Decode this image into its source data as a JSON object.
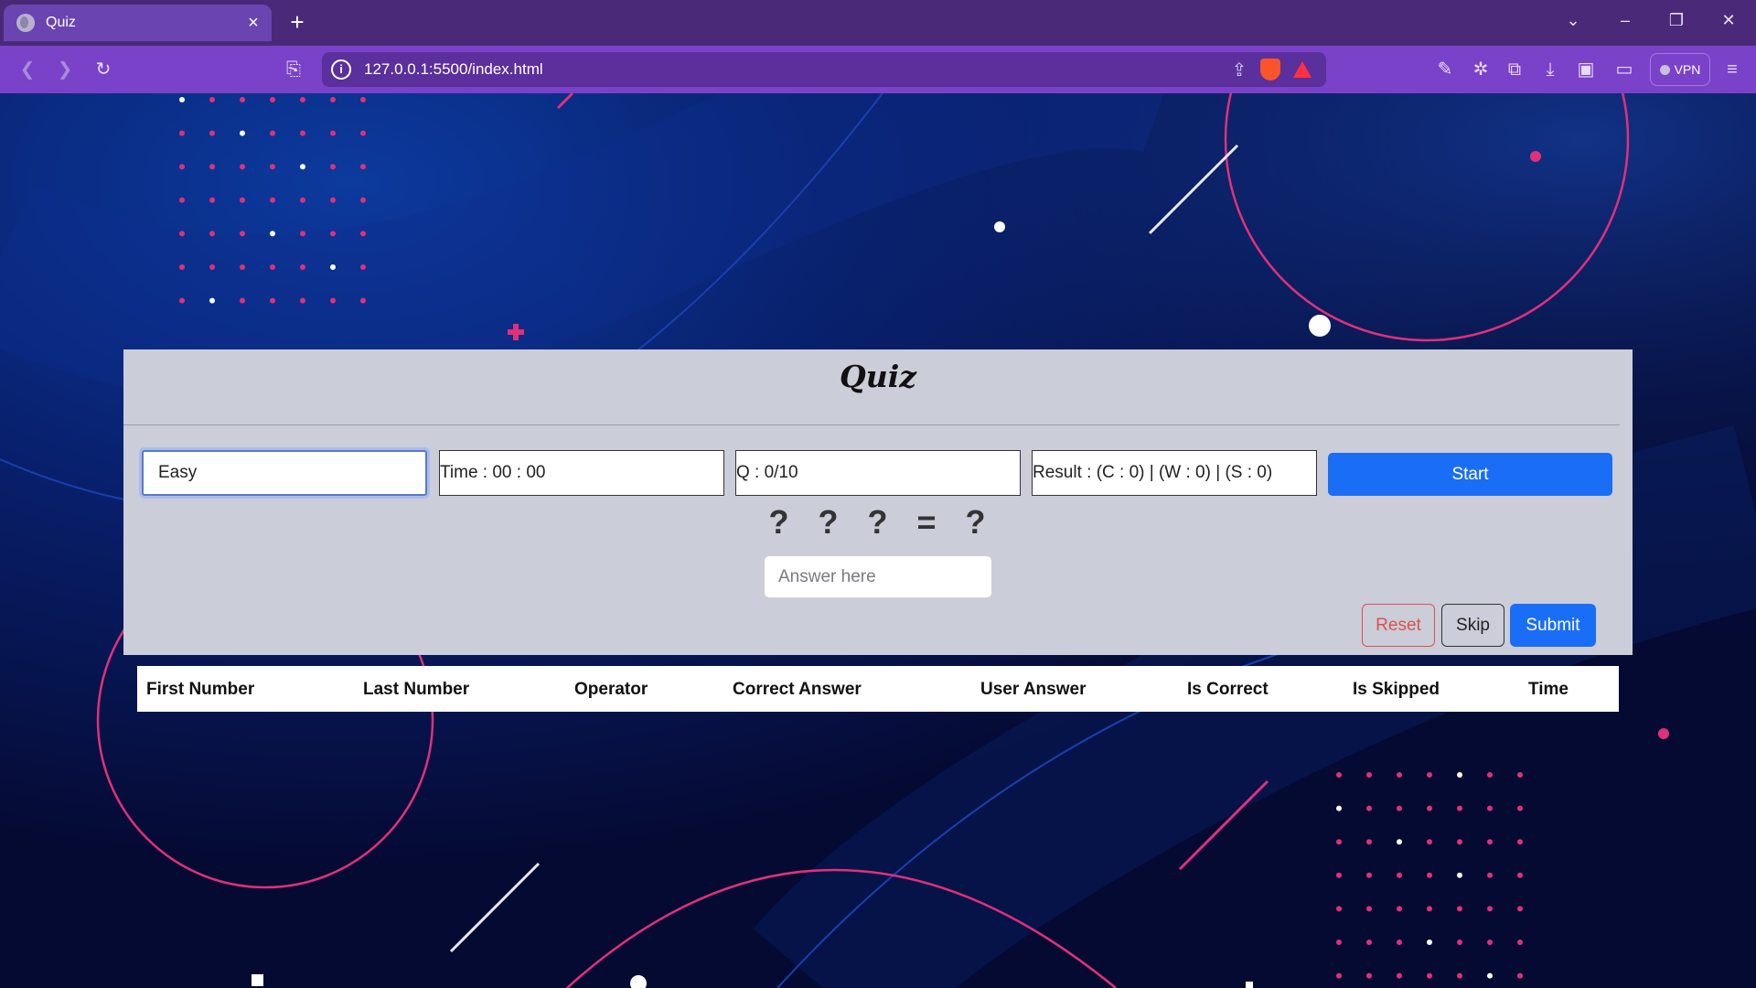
{
  "browser": {
    "tab_title": "Quiz",
    "tab_close": "×",
    "new_tab": "+",
    "url": "127.0.0.1:5500/index.html",
    "vpn_label": "VPN",
    "icons": [
      "back-icon",
      "forward-icon",
      "reload-icon",
      "bookmark-icon",
      "info-icon",
      "share-icon",
      "brave-shields-icon",
      "brave-rewards-icon",
      "brush-icon",
      "leo-icon",
      "extensions-icon",
      "download-icon",
      "sidebar-icon",
      "wallet-icon",
      "menu-icon"
    ]
  },
  "quiz": {
    "title": "Quiz",
    "difficulty": "Easy",
    "time": "Time : 00 : 00",
    "question": "Q : 0/10",
    "result": "Result : (C : 0) | (W : 0) | (S : 0)",
    "start_label": "Start",
    "equation": "? ? ? = ?",
    "answer_placeholder": "Answer here",
    "reset_label": "Reset",
    "skip_label": "Skip",
    "submit_label": "Submit",
    "colors": {
      "primary": "#1a6ef5",
      "danger": "#d9534f",
      "card": "#cbcdd8"
    }
  },
  "table": {
    "headers": [
      "First Number",
      "Last Number",
      "Operator",
      "Correct Answer",
      "User Answer",
      "Is Correct",
      "Is Skipped",
      "Time"
    ],
    "rows": []
  }
}
